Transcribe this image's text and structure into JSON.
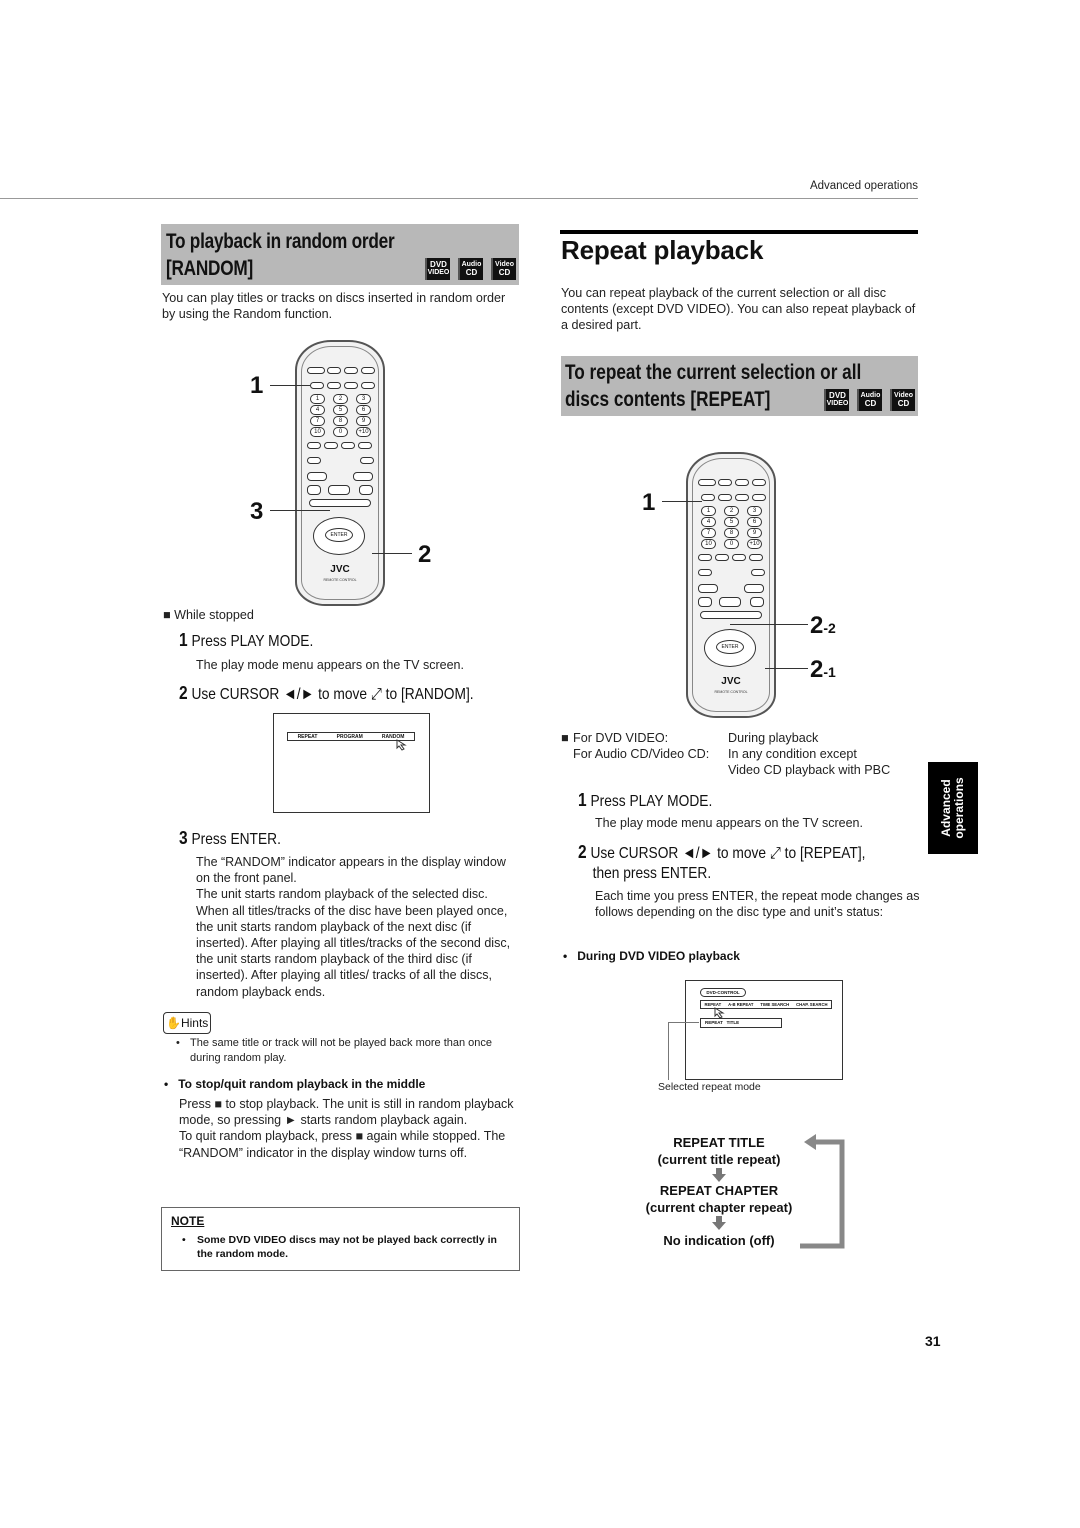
{
  "header": {
    "running_head": "Advanced operations"
  },
  "page_number": "31",
  "side_tab": {
    "line1": "Advanced",
    "line2": "operations"
  },
  "left": {
    "section_title_line1": "To playback  in random order",
    "section_title_line2": "[RANDOM]",
    "badges": [
      {
        "top": "DVD",
        "bottom": "VIDEO",
        "icon": "dvd-video-badge"
      },
      {
        "top": "Audio",
        "bottom": "CD",
        "icon": "audio-cd-badge"
      },
      {
        "top": "Video",
        "bottom": "CD",
        "icon": "video-cd-badge"
      }
    ],
    "intro": "You can play titles or tracks on discs inserted in random order by using the Random function.",
    "callouts": [
      "1",
      "3",
      "2"
    ],
    "remote": {
      "brand": "JVC",
      "label": "REMOTE CONTROL",
      "enter": "ENTER"
    },
    "condition": "While stopped",
    "steps": [
      {
        "num": "1",
        "text": "Press PLAY MODE.",
        "desc": "The play mode menu appears on the TV screen."
      },
      {
        "num": "2",
        "text": "Use CURSOR ◄/► to move ⤢ to [RANDOM].",
        "desc": ""
      },
      {
        "num": "3",
        "text": "Press ENTER.",
        "desc": "The “RANDOM” indicator appears in the display window on the front panel.\nThe unit starts random playback of the selected disc. When all titles/tracks of the disc have been played once, the unit starts random playback of the next disc (if inserted). After playing all titles/tracks of the second disc, the unit starts random playback of the third disc (if inserted). After playing all titles/ tracks of all the discs, random playback ends."
      }
    ],
    "screen_menu": [
      "REPEAT",
      "PROGRAM",
      "RANDOM"
    ],
    "hints_label": "Hints",
    "hint": "The same title or track will not be played back more than once during random play.",
    "stop_heading": "To stop/quit random playback in the middle",
    "stop_text": "Press ■ to stop playback. The unit is still in random playback mode, so pressing ► starts random playback again.\nTo quit random playback, press ■ again while stopped. The “RANDOM” indicator in the display window turns off.",
    "note_label": "NOTE",
    "note": "Some DVD VIDEO discs may not be played back correctly in the random mode."
  },
  "right": {
    "title": "Repeat playback",
    "intro": "You can repeat playback of the current selection or all disc contents (except DVD VIDEO). You can also repeat playback of a desired part.",
    "section_title_line1": "To repeat the current selection or all",
    "section_title_line2": "discs contents [REPEAT]",
    "callouts": [
      "1",
      "2-2",
      "2-1"
    ],
    "conditions": [
      {
        "label": "For DVD VIDEO:",
        "value": "During playback"
      },
      {
        "label": "For Audio CD/Video CD:",
        "value": "In any condition except\nVideo CD playback with PBC"
      }
    ],
    "steps": [
      {
        "num": "1",
        "text": "Press PLAY MODE.",
        "desc": "The play mode menu appears on the TV screen."
      },
      {
        "num": "2",
        "text_line1": "Use CURSOR ◄/► to move ⤢ to [REPEAT],",
        "text_line2": "then press ENTER.",
        "desc": "Each time you press ENTER, the repeat mode changes as follows depending on the disc type and unit’s status:"
      }
    ],
    "dvd_heading": "During DVD VIDEO playback",
    "screen": {
      "control_label": "DVD-CONTROL",
      "menu": [
        "REPEAT",
        "A-B REPEAT",
        "TIME SEARCH",
        "CHAP. SEARCH"
      ],
      "selected": "REPEAT   TITLE",
      "caption": "Selected repeat mode"
    },
    "flow": [
      {
        "mode": "REPEAT TITLE",
        "desc": "(current title repeat)"
      },
      {
        "mode": "REPEAT CHAPTER",
        "desc": "(current chapter repeat)"
      },
      {
        "mode": "No indication (off)",
        "desc": ""
      }
    ]
  }
}
